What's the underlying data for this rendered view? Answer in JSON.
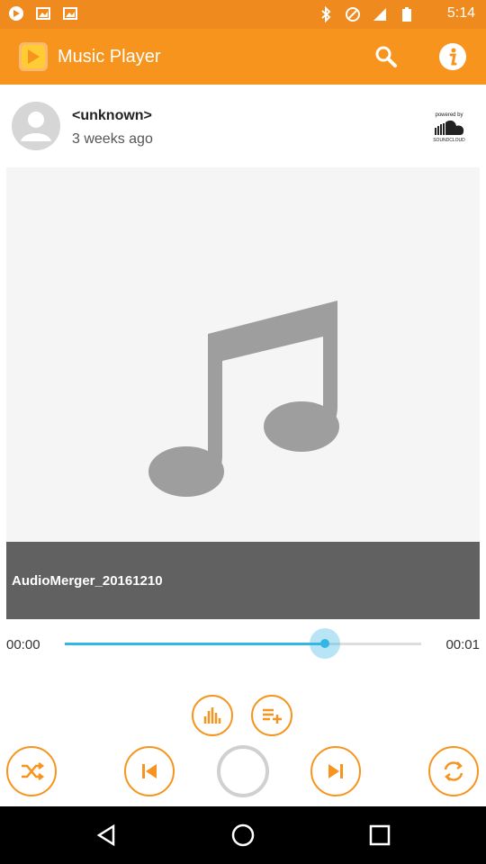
{
  "status_bar": {
    "time": "5:14"
  },
  "app_bar": {
    "title": "Music Player"
  },
  "track": {
    "artist": "<unknown>",
    "posted": "3 weeks ago",
    "provider": "powered by SOUNDCLOUD",
    "title": "AudioMerger_20161210"
  },
  "progress": {
    "elapsed": "00:00",
    "total": "00:01",
    "fraction": 0.73
  },
  "colors": {
    "accent": "#f7941d",
    "seek": "#33b5e5",
    "status_bar": "#ef8a1f"
  },
  "icons": [
    "app-logo-icon",
    "search-icon",
    "info-icon",
    "avatar-icon",
    "soundcloud-logo",
    "music-note-icon",
    "equalizer-icon",
    "add-to-playlist-icon",
    "shuffle-icon",
    "previous-icon",
    "loading-spinner",
    "next-icon",
    "repeat-icon"
  ]
}
